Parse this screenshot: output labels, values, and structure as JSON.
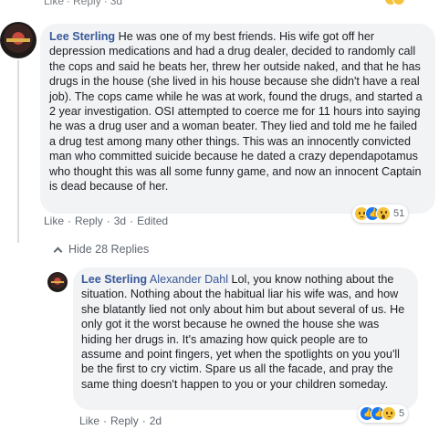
{
  "top_actions": {
    "like": "Like",
    "reply": "Reply",
    "time": "3d"
  },
  "comment": {
    "author": "Lee Sterling",
    "text": "He was one of my best friends. His wife got off her depression medications and had a drug dealer, decided to randomly call the cops and said he beats her, threw her outside naked, and that he has drugs in the house (she lived in his house because she didn't have a real job). The cops came while he was at work, found the drugs, and started a 2 year investigation. OSI attempted to coerce me for 11 hours into saying he was a drug user and a woman beater. They lied and told me he failed a drug test among many other things. This was an innocently convicted man who committed suicide because he dated a crazy dependapotamus who thought this was all some funny game, and now an innocent Captain is dead because of her.",
    "actions": {
      "like": "Like",
      "reply": "Reply",
      "time": "3d",
      "edited": "Edited"
    },
    "reactions": {
      "icons": [
        "sad-emoji",
        "like-emoji",
        "wow-emoji"
      ],
      "count": "51"
    }
  },
  "replies_toggle": {
    "label": "Hide 28 Replies"
  },
  "reply": {
    "author": "Lee Sterling",
    "mention": "Alexander Dahl",
    "text": "Lol, you know nothing about the situation. Nothing about the habitual liar his wife was, and how she blatantly lied not only about him but about several of us. He only got it the worst because he owned the house she was hiding her drugs in. It's amazing how quick people are to assume and point fingers, yet when the spotlights on you you'll be the first to cry victim. Spare us all the facade, and pray the same thing doesn't happen to you or your children someday.",
    "actions": {
      "like": "Like",
      "reply": "Reply",
      "time": "2d"
    },
    "reactions": {
      "icons": [
        "like-emoji",
        "like-emoji",
        "sad-emoji"
      ],
      "count": "5"
    }
  }
}
